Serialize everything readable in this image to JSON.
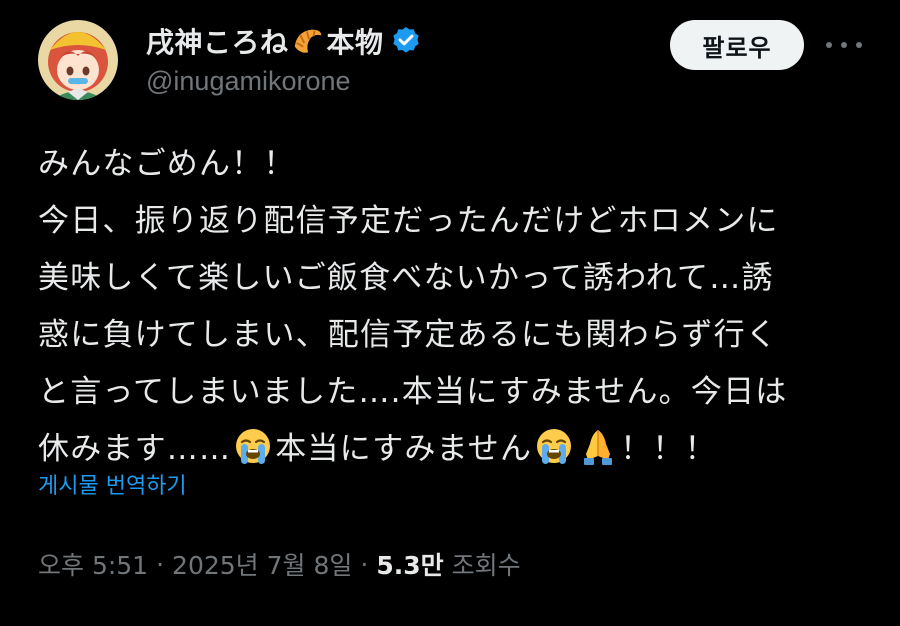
{
  "author": {
    "display_name": "戌神ころね",
    "display_suffix": "本物",
    "handle": "@inugamikorone",
    "avatar_icon": "avatar-icon",
    "verified": true
  },
  "header": {
    "follow_label": "팔로우",
    "more_icon": "more-icon"
  },
  "tweet": {
    "lines": [
      "みんなごめん！！",
      "今日、振り返り配信予定だったんだけどホロメンに",
      "美味しくて楽しいご飯食べないかって誘われて…誘",
      "惑に負けてしまい、配信予定あるにも関わらず行く",
      "と言ってしまいました….本当にすみません。今日は"
    ],
    "last_line_part1": "休みます……",
    "last_line_part2": "本当にすみません",
    "last_line_part3": "！！！",
    "emojis": [
      "loudly-crying-face",
      "loudly-crying-face",
      "folded-hands"
    ]
  },
  "translate_label": "게시물 번역하기",
  "meta": {
    "time": "오후 5:51",
    "separator": "·",
    "date": "2025년 7월 8일",
    "views_count": "5.3만",
    "views_label": "조회수"
  },
  "colors": {
    "background": "#000000",
    "text": "#e7e9ea",
    "muted": "#71767b",
    "link": "#1d9bf0",
    "verified": "#1d9bf0"
  }
}
